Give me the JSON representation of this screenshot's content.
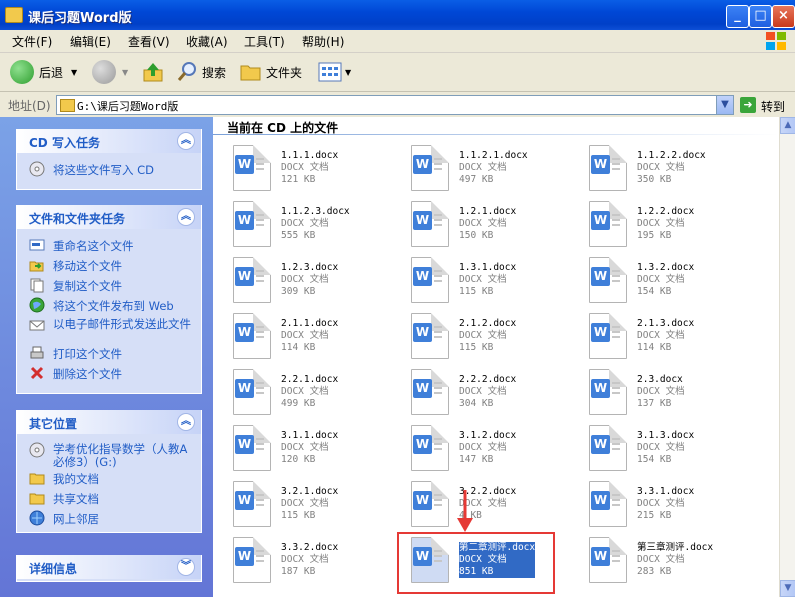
{
  "window": {
    "title": "课后习题Word版"
  },
  "menu": [
    "文件(F)",
    "编辑(E)",
    "查看(V)",
    "收藏(A)",
    "工具(T)",
    "帮助(H)"
  ],
  "toolbar": {
    "back": "后退",
    "search": "搜索",
    "folders": "文件夹"
  },
  "address": {
    "label": "地址(D)",
    "path": "G:\\课后习题Word版",
    "go": "转到"
  },
  "left": {
    "cd_tasks": {
      "title": "CD 写入任务",
      "items": [
        "将这些文件写入 CD"
      ]
    },
    "file_tasks": {
      "title": "文件和文件夹任务",
      "items": [
        "重命名这个文件",
        "移动这个文件",
        "复制这个文件",
        "将这个文件发布到 Web",
        "以电子邮件形式发送此文件",
        "打印这个文件",
        "删除这个文件"
      ]
    },
    "other_places": {
      "title": "其它位置",
      "items": [
        "学考优化指导数学（人教A必修3）(G:)",
        "我的文档",
        "共享文档",
        "网上邻居"
      ]
    },
    "details": {
      "title": "详细信息"
    }
  },
  "content": {
    "header": "当前在 CD 上的文件",
    "files": [
      {
        "name": "1.1.1.docx",
        "type": "DOCX 文档",
        "size": "121 KB"
      },
      {
        "name": "1.1.2.1.docx",
        "type": "DOCX 文档",
        "size": "497 KB"
      },
      {
        "name": "1.1.2.2.docx",
        "type": "DOCX 文档",
        "size": "350 KB"
      },
      {
        "name": "1.1.2.3.docx",
        "type": "DOCX 文档",
        "size": "555 KB"
      },
      {
        "name": "1.2.1.docx",
        "type": "DOCX 文档",
        "size": "150 KB"
      },
      {
        "name": "1.2.2.docx",
        "type": "DOCX 文档",
        "size": "195 KB"
      },
      {
        "name": "1.2.3.docx",
        "type": "DOCX 文档",
        "size": "309 KB"
      },
      {
        "name": "1.3.1.docx",
        "type": "DOCX 文档",
        "size": "115 KB"
      },
      {
        "name": "1.3.2.docx",
        "type": "DOCX 文档",
        "size": "154 KB"
      },
      {
        "name": "2.1.1.docx",
        "type": "DOCX 文档",
        "size": "114 KB"
      },
      {
        "name": "2.1.2.docx",
        "type": "DOCX 文档",
        "size": "115 KB"
      },
      {
        "name": "2.1.3.docx",
        "type": "DOCX 文档",
        "size": "114 KB"
      },
      {
        "name": "2.2.1.docx",
        "type": "DOCX 文档",
        "size": "499 KB"
      },
      {
        "name": "2.2.2.docx",
        "type": "DOCX 文档",
        "size": "304 KB"
      },
      {
        "name": "2.3.docx",
        "type": "DOCX 文档",
        "size": "137 KB"
      },
      {
        "name": "3.1.1.docx",
        "type": "DOCX 文档",
        "size": "120 KB"
      },
      {
        "name": "3.1.2.docx",
        "type": "DOCX 文档",
        "size": "147 KB"
      },
      {
        "name": "3.1.3.docx",
        "type": "DOCX 文档",
        "size": "154 KB"
      },
      {
        "name": "3.2.1.docx",
        "type": "DOCX 文档",
        "size": "115 KB"
      },
      {
        "name": "3.2.2.docx",
        "type": "DOCX 文档",
        "size": "4 KB"
      },
      {
        "name": "3.3.1.docx",
        "type": "DOCX 文档",
        "size": "215 KB"
      },
      {
        "name": "3.3.2.docx",
        "type": "DOCX 文档",
        "size": "187 KB"
      },
      {
        "name": "第二章测评.docx",
        "type": "DOCX 文档",
        "size": "851 KB",
        "selected": true
      },
      {
        "name": "第三章测评.docx",
        "type": "DOCX 文档",
        "size": "283 KB"
      }
    ]
  },
  "colors": {
    "title_bar": "#0047d6",
    "panel_bg": "#d6dff7",
    "link_text": "#215dc6",
    "selection": "#316ac5",
    "highlight_box": "#e53935"
  }
}
